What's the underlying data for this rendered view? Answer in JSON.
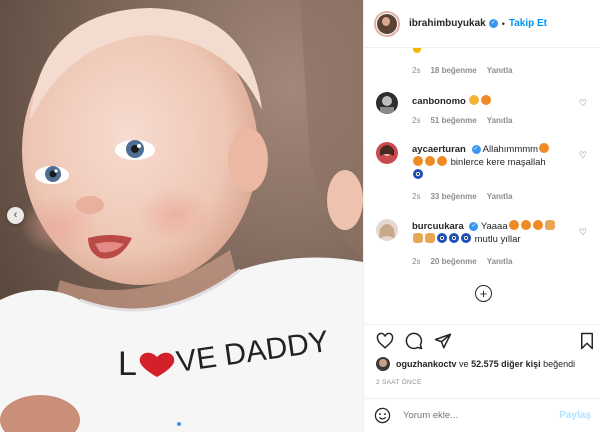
{
  "header": {
    "username": "ibrahimbuyukak",
    "separator": "•",
    "follow_label": "Takip Et"
  },
  "photo": {
    "shirt_text_l": "L",
    "shirt_text_rest": "VE DADDY"
  },
  "comments": [
    {
      "username": "",
      "text": "",
      "time": "2s",
      "likes": "18 beğenme",
      "reply": "Yanıtla"
    },
    {
      "username": "canbonomo",
      "text": "",
      "time": "2s",
      "likes": "51 beğenme",
      "reply": "Yanıtla"
    },
    {
      "username": "aycaerturan",
      "text": "Allahımmmm",
      "text2": "binlerce kere maşallah",
      "time": "2s",
      "likes": "33 beğenme",
      "reply": "Yanıtla"
    },
    {
      "username": "burcuukara",
      "text": "Yaaaa",
      "text2": "mutlu yıllar",
      "time": "2s",
      "likes": "20 beğenme",
      "reply": "Yanıtla"
    }
  ],
  "likes": {
    "user": "oguzhankoctv",
    "connector": "ve",
    "count": "52.575 diğer kişi",
    "suffix": "beğendi"
  },
  "timestamp": "2 SAAT ÖNCE",
  "add_comment": {
    "placeholder": "Yorum ekle...",
    "post_label": "Paylaş"
  },
  "icons": [
    "chevron-left-icon",
    "verified-badge-icon",
    "heart-icon",
    "comment-icon",
    "share-icon",
    "bookmark-icon",
    "plus-circle-icon",
    "smiley-icon"
  ],
  "colors": {
    "accent": "#0095f6",
    "verified": "#3897f0",
    "muted": "#8e8e8e",
    "post_disabled": "#b2dffc"
  }
}
